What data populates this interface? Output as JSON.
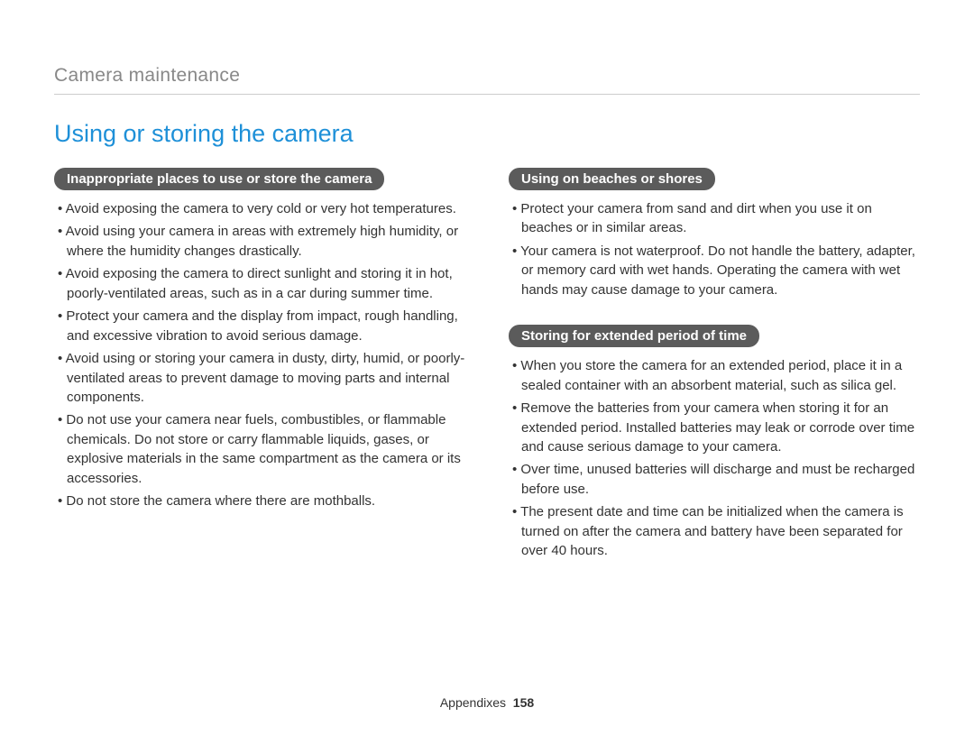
{
  "header": "Camera maintenance",
  "title": "Using or storing the camera",
  "left": {
    "pill1": "Inappropriate places to use or store the camera",
    "items1": [
      "Avoid exposing the camera to very cold or very hot temperatures.",
      "Avoid using your camera in areas with extremely high humidity, or where the humidity changes drastically.",
      "Avoid exposing the camera to direct sunlight and storing it in hot, poorly-ventilated areas, such as in a car during summer time.",
      "Protect your camera and the display from impact, rough handling, and excessive vibration to avoid serious damage.",
      "Avoid using or storing your camera in dusty, dirty, humid, or poorly-ventilated areas to prevent damage to moving parts and internal components.",
      "Do not use your camera near fuels, combustibles, or flammable chemicals. Do not store or carry flammable liquids, gases, or explosive materials in the same compartment as the camera or its accessories.",
      "Do not store the camera where there are mothballs."
    ]
  },
  "right": {
    "pill1": "Using on beaches or shores",
    "items1": [
      "Protect your camera from sand and dirt when you use it on beaches or in similar areas.",
      "Your camera is not waterproof. Do not handle the battery, adapter, or memory card with wet hands. Operating the camera with wet hands may cause damage to your camera."
    ],
    "pill2": "Storing for extended period of time",
    "items2": [
      "When you store the camera for an extended period, place it in a sealed container with an absorbent material, such as silica gel.",
      "Remove the batteries from your camera when storing it for an extended period. Installed batteries may leak or corrode over time and cause serious damage to your camera.",
      "Over time, unused batteries will discharge and must be recharged before use.",
      "The present date and time can be initialized when the camera is turned on after the camera and battery have been separated for over 40 hours."
    ]
  },
  "footer": {
    "label": "Appendixes",
    "page": "158"
  }
}
